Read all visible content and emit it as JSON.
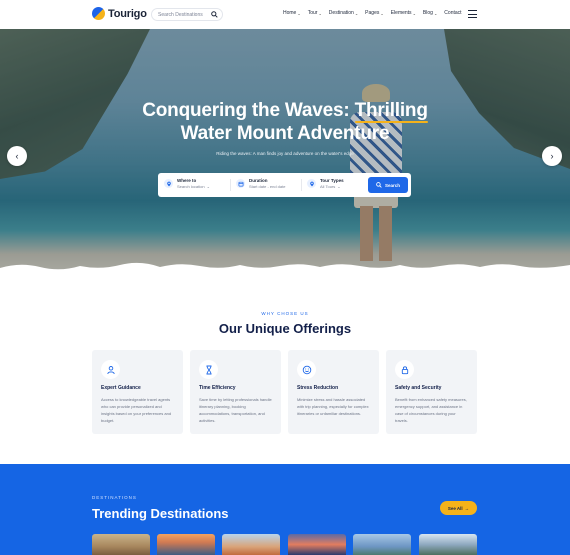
{
  "header": {
    "logo_text": "Tourigo",
    "search_placeholder": "Search Destinations",
    "nav": [
      {
        "label": "Home",
        "has_dropdown": true
      },
      {
        "label": "Tour",
        "has_dropdown": true
      },
      {
        "label": "Destination",
        "has_dropdown": true
      },
      {
        "label": "Pages",
        "has_dropdown": true
      },
      {
        "label": "Elements",
        "has_dropdown": true
      },
      {
        "label": "Blog",
        "has_dropdown": true
      },
      {
        "label": "Contact",
        "has_dropdown": false
      }
    ]
  },
  "hero": {
    "title_line1_prefix": "Conquering the Waves: ",
    "title_line1_highlight": "Thrilling",
    "title_line2": "Water Mount Adventure",
    "subtitle": "Riding the waves: A man finds joy and adventure on the water's edge",
    "search": {
      "where_label": "Where to",
      "where_value": "Search location",
      "duration_label": "Duration",
      "duration_value": "Start date - end date",
      "types_label": "Tour Types",
      "types_value": "All Tours",
      "button_label": "Search"
    }
  },
  "offerings": {
    "eyebrow": "WHY CHOSE US",
    "title": "Our Unique Offerings",
    "cards": [
      {
        "icon": "user-icon",
        "title": "Expert Guidance",
        "desc": "Access to knowledgeable travel agents who can provide personalized and insights based on your preferences and budget."
      },
      {
        "icon": "hourglass-icon",
        "title": "Time Efficiency",
        "desc": "Save time by letting professionals handle itinerary planning, booking accommodations, transportation, and activities."
      },
      {
        "icon": "smile-icon",
        "title": "Stress Reduction",
        "desc": "Minimize stress and hassle associated with trip planning, especially for complex itineraries or unfamiliar destinations."
      },
      {
        "icon": "lock-icon",
        "title": "Safety and Security",
        "desc": "Benefit from enhanced safety measures, emergency support, and assistance in case of circumstances during your travels."
      }
    ]
  },
  "destinations": {
    "eyebrow": "DESTINATIONS",
    "title": "Trending Destinations",
    "see_all": "See All"
  },
  "colors": {
    "primary": "#1f68e8",
    "accent": "#f5b21a",
    "dark": "#13204a",
    "destinations_bg": "#1565e4"
  }
}
